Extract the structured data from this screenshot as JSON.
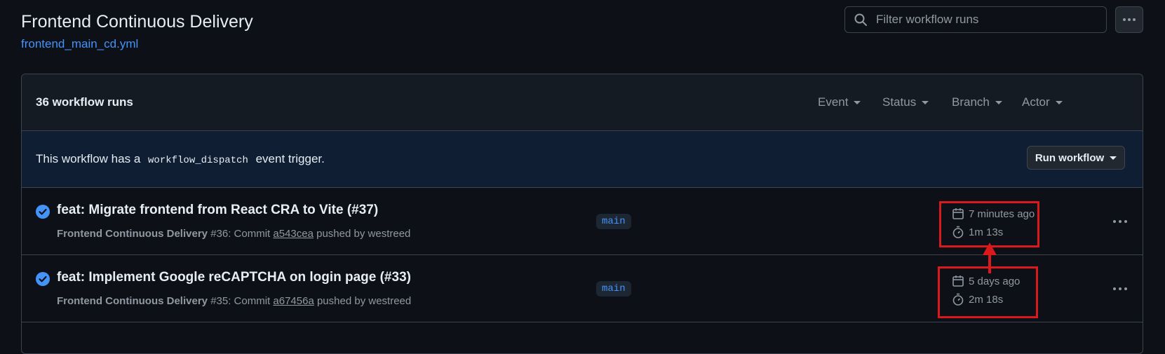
{
  "header": {
    "title": "Frontend Continuous Delivery",
    "file_link": "frontend_main_cd.yml"
  },
  "search": {
    "placeholder": "Filter workflow runs",
    "value": ""
  },
  "list": {
    "runs_count": "36 workflow runs",
    "filters": [
      "Event",
      "Status",
      "Branch",
      "Actor"
    ]
  },
  "dispatch": {
    "prefix": "This workflow has a",
    "code": "workflow_dispatch",
    "suffix": "event trigger.",
    "button_label": "Run workflow"
  },
  "runs": [
    {
      "title": "feat: Migrate frontend from React CRA to Vite (#37)",
      "workflow": "Frontend Continuous Delivery",
      "number": "#36: Commit",
      "sha": "a543cea",
      "pushed_by": "pushed by westreed",
      "branch": "main",
      "time_ago": "7 minutes ago",
      "duration": "1m 13s",
      "status": "success"
    },
    {
      "title": "feat: Implement Google reCAPTCHA on login page (#33)",
      "workflow": "Frontend Continuous Delivery",
      "number": "#35: Commit",
      "sha": "a67456a",
      "pushed_by": "pushed by westreed",
      "branch": "main",
      "time_ago": "5 days ago",
      "duration": "2m 18s",
      "status": "success"
    }
  ],
  "colors": {
    "background": "#0d1117",
    "accent": "#4493f8",
    "success": "#4493f8",
    "annotation": "#d9191c"
  }
}
